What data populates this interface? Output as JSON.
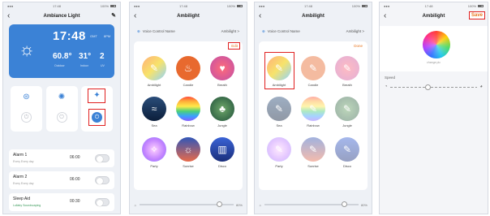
{
  "status": {
    "time": "17:48",
    "right": "100%"
  },
  "screen1": {
    "title": "Ambiance Light",
    "weather": {
      "time": "17:48",
      "ampm_left": "GMT",
      "ampm_right": "8PM",
      "temp": "60.8°",
      "temp_label": "Outdoor",
      "humidity": "31°",
      "humidity_label": "Indoor",
      "count": "2",
      "count_label": "UV"
    },
    "alarms": [
      {
        "name": "Alarm 1",
        "sub": "Every Every day",
        "time": "06:00"
      },
      {
        "name": "Alarm 2",
        "sub": "Every Every day",
        "time": "06:00"
      },
      {
        "name": "Sleep Aid",
        "sub": "Lullaby Soundscaping",
        "time": "00:30"
      }
    ]
  },
  "screen2": {
    "title": "Ambilight",
    "voice_label": "Voice Control Name",
    "voice_value": "Ambilight >",
    "edit": "Edit",
    "items": [
      "Ambilight",
      "Candle",
      "Breath",
      "Sea",
      "Rainbow",
      "Jungle",
      "Party",
      "Sunrise",
      "Disco"
    ],
    "slider_value": "80%"
  },
  "screen3": {
    "title": "Ambilight",
    "voice_label": "Voice Control Name",
    "voice_value": "Ambilight >",
    "done": "Done",
    "items": [
      "Ambilight",
      "Candle",
      "Breath",
      "Sea",
      "Rainbow",
      "Jungle",
      "Party",
      "Sunrise",
      "Disco"
    ],
    "slider_value": "80%"
  },
  "screen4": {
    "title": "Ambilight",
    "save": "Save",
    "color_label": "change pic",
    "speed_label": "Speed"
  },
  "colors": {
    "accent": "#3b82d6",
    "highlight": "#e02020",
    "orange": "#e87722"
  }
}
